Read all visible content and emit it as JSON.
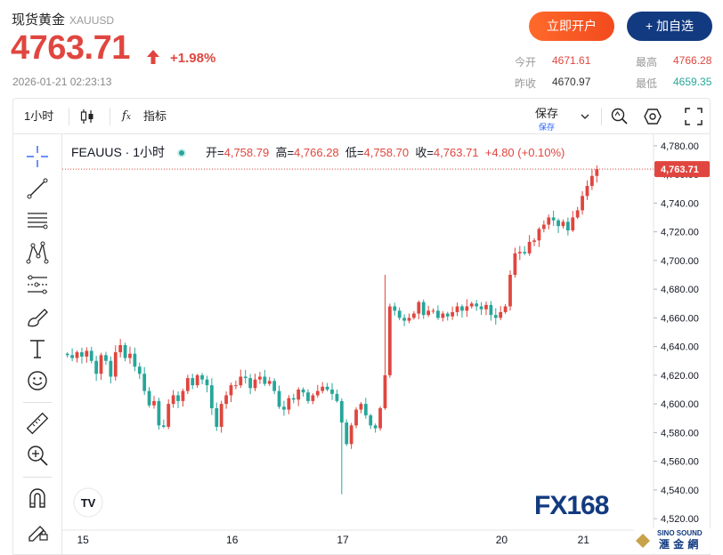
{
  "header": {
    "name": "现货黄金",
    "code": "XAUUSD",
    "price": "4763.71",
    "change_pct": "+1.98%",
    "timestamp": "2026-01-21 02:23:13",
    "btn_open": "立即开户",
    "btn_watch": "+ 加自选"
  },
  "stats": {
    "open_label": "今开",
    "open": "4671.61",
    "high_label": "最高",
    "high": "4766.28",
    "prev_label": "昨收",
    "prev": "4670.97",
    "low_label": "最低",
    "low": "4659.35"
  },
  "toolbar": {
    "interval": "1小时",
    "indicator": "指标",
    "save_label": "保存",
    "save_sub": "保存"
  },
  "legend": {
    "symbol": "FEAUUS · 1小时",
    "open_label": "开=",
    "open": "4,758.79",
    "high_label": "高=",
    "high": "4,766.28",
    "low_label": "低=",
    "low": "4,758.70",
    "close_label": "收=",
    "close": "4,763.71",
    "change": "+4.80 (+0.10%)"
  },
  "colors": {
    "up": "#e0463f",
    "down": "#26a69a",
    "accent": "#2962ff",
    "brand_navy": "#123a80",
    "brand_orange": "#f24a1e"
  },
  "chart_data": {
    "type": "candlestick",
    "interval": "1小时",
    "x_ticks": [
      "15",
      "16",
      "17",
      "20",
      "21"
    ],
    "y_ticks": [
      "4,520.00",
      "4,540.00",
      "4,560.00",
      "4,580.00",
      "4,600.00",
      "4,620.00",
      "4,640.00",
      "4,660.00",
      "4,680.00",
      "4,700.00",
      "4,720.00",
      "4,740.00",
      "4,760.00",
      "4,780.00"
    ],
    "ylim": [
      4512,
      4788
    ],
    "last_price_label": "4,763.71",
    "last_price": 4763.71,
    "close": [
      4634,
      4632,
      4636,
      4633,
      4637,
      4630,
      4621,
      4634,
      4630,
      4619,
      4636,
      4641,
      4632,
      4635,
      4626,
      4621,
      4609,
      4599,
      4602,
      4585,
      4584,
      4600,
      4606,
      4602,
      4609,
      4618,
      4613,
      4620,
      4617,
      4613,
      4597,
      4584,
      4600,
      4606,
      4613,
      4613,
      4619,
      4618,
      4611,
      4617,
      4619,
      4614,
      4616,
      4609,
      4598,
      4596,
      4604,
      4603,
      4610,
      4608,
      4602,
      4606,
      4609,
      4612,
      4610,
      4607,
      4602,
      4587,
      4572,
      4585,
      4596,
      4600,
      4592,
      4585,
      4583,
      4597,
      4620,
      4668,
      4665,
      4660,
      4658,
      4660,
      4663,
      4671,
      4662,
      4665,
      4665,
      4660,
      4663,
      4661,
      4664,
      4668,
      4665,
      4668,
      4670,
      4668,
      4666,
      4669,
      4662,
      4660,
      4664,
      4668,
      4690,
      4705,
      4706,
      4705,
      4713,
      4714,
      4722,
      4725,
      4730,
      4728,
      4724,
      4727,
      4721,
      4730,
      4735,
      4745,
      4752,
      4759,
      4763.71
    ],
    "labels": {
      "title": "",
      "xlabel": "",
      "ylabel": ""
    }
  },
  "watermark": {
    "brand": "FX168",
    "corner_line1": "SINO SOUND",
    "corner_line2": "滙 金 網"
  }
}
